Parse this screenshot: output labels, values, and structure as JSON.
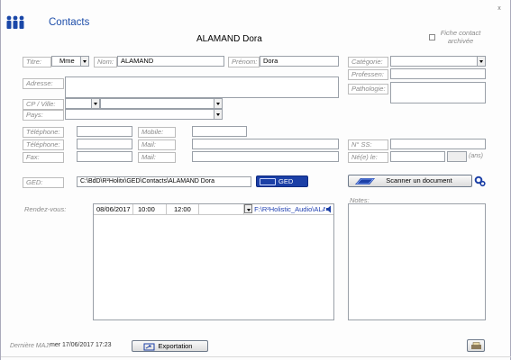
{
  "header": {
    "title": "Contacts",
    "contact_name": "ALAMAND Dora",
    "archive_checkbox_label_line1": "Fiche contact",
    "archive_checkbox_label_line2": "archivée",
    "close_symbol": "x"
  },
  "form": {
    "titre_label": "Titre:",
    "titre_value": "Mme",
    "nom_label": "Nom:",
    "nom_value": "ALAMAND",
    "prenom_label": "Prénom:",
    "prenom_value": "Dora",
    "adresse_label": "Adresse:",
    "cp_ville_label": "CP / Ville:",
    "pays_label": "Pays:",
    "telephone1_label": "Téléphone:",
    "telephone2_label": "Téléphone:",
    "fax_label": "Fax:",
    "mobile_label": "Mobile:",
    "mail1_label": "Mail:",
    "mail2_label": "Mail:",
    "categorie_label": "Catégorie:",
    "profession_label": "Professen:",
    "pathologie_label": "Pathologie:",
    "ss_label": "N° SS:",
    "nele_label": "Né(e) le:",
    "ans_label": "(ans)",
    "ged_label": "GED:",
    "ged_path": "C:\\BdD\\R²Holitx\\GED\\Contacts\\ALAMAND Dora",
    "ged_button": "GED",
    "scan_button": "Scanner un document",
    "notes_label": "Notes:",
    "rdv_label": "Rendez-vous:"
  },
  "appointments": [
    {
      "date": "08/06/2017",
      "start": "10:00",
      "end": "12:00",
      "file": "F:\\R²Holistic_Audio\\ALA"
    }
  ],
  "footer": {
    "last_update_label": "Dernière MAJ:",
    "last_update_value": "mer 17/06/2017 17:23",
    "export_button": "Exportation"
  },
  "colors": {
    "title": "#1f4faa",
    "logo": "#1a47a8",
    "ged_button_bg": "#1b3fa6",
    "scan_button_icon": "#1b3fa6"
  }
}
